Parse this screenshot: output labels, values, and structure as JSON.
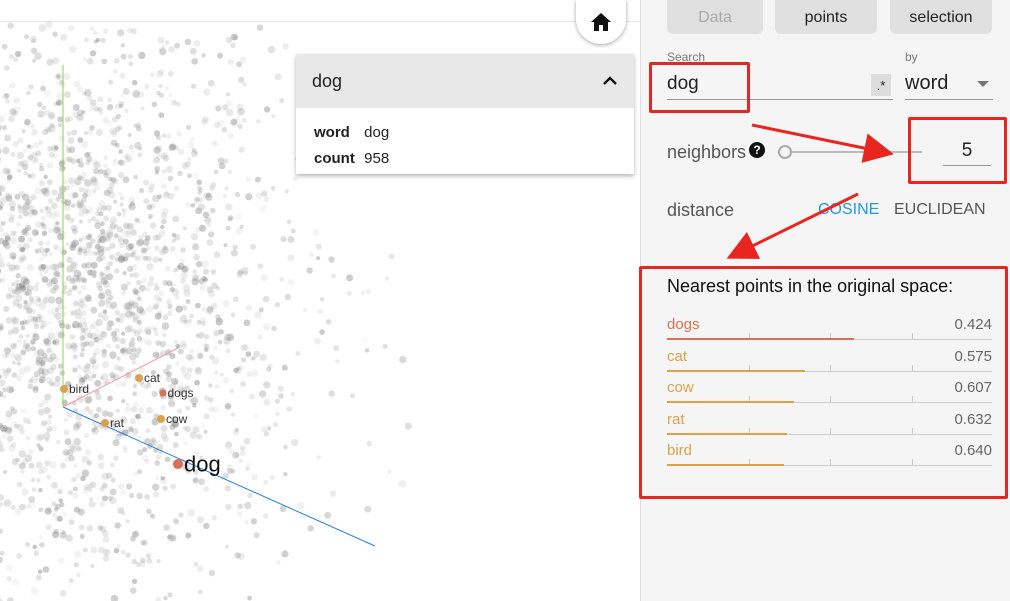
{
  "tabs": [
    {
      "label": "Data",
      "muted": true
    },
    {
      "label": "points",
      "muted": false
    },
    {
      "label": "selection",
      "muted": false
    }
  ],
  "search": {
    "label": "Search",
    "value": "dog",
    "regex_label": ".*"
  },
  "by": {
    "label": "by",
    "value": "word"
  },
  "neighbors": {
    "label": "neighbors",
    "help": "?",
    "value": "5"
  },
  "distance": {
    "label": "distance",
    "options": [
      "COSINE",
      "EUCLIDEAN"
    ],
    "selected": "COSINE"
  },
  "nearest": {
    "title": "Nearest points in the original space:",
    "items": [
      {
        "word": "dogs",
        "value": "0.424",
        "color": "#d96f55"
      },
      {
        "word": "cat",
        "value": "0.575",
        "color": "#dba24c"
      },
      {
        "word": "cow",
        "value": "0.607",
        "color": "#dba24c"
      },
      {
        "word": "rat",
        "value": "0.632",
        "color": "#dba24c"
      },
      {
        "word": "bird",
        "value": "0.640",
        "color": "#dba24c"
      }
    ]
  },
  "info_card": {
    "title": "dog",
    "fields": [
      {
        "key": "word",
        "value": "dog"
      },
      {
        "key": "count",
        "value": "958"
      }
    ]
  },
  "plot_labels": [
    "bird",
    "cat",
    "dogs",
    "rat",
    "cow",
    "dog"
  ],
  "colors": {
    "accent": "#1e9bd7",
    "annotation": "#e8261f",
    "selected_point": "#d96f55",
    "neighbor_point": "#dba24c"
  }
}
